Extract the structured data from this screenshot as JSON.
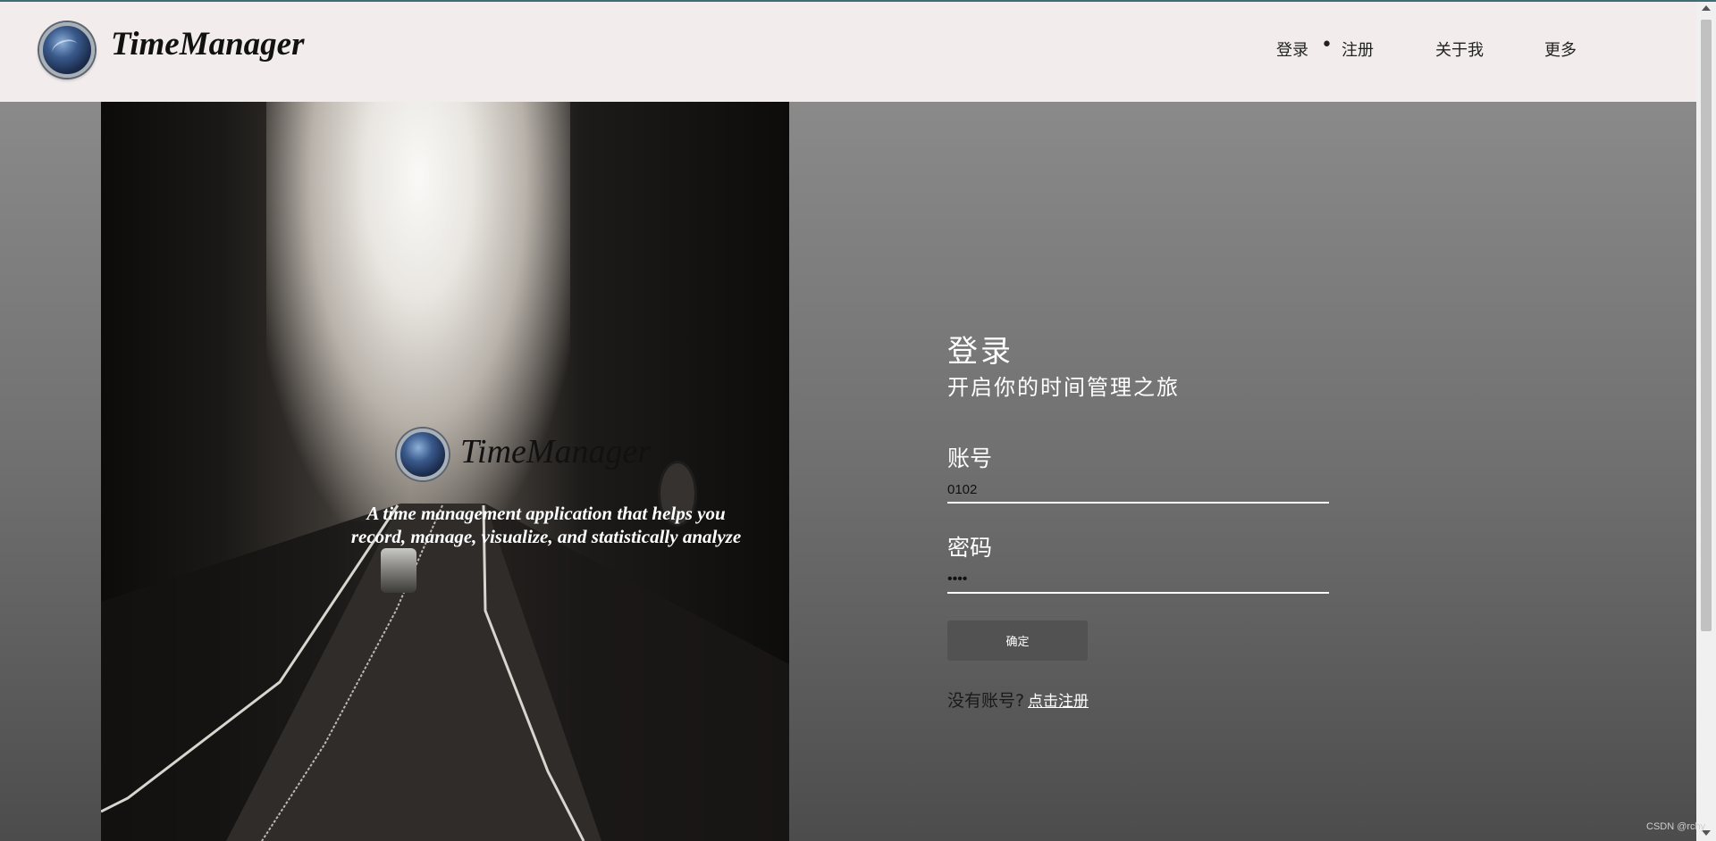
{
  "header": {
    "brand": "TimeManager",
    "nav": {
      "login": "登录",
      "separator": "•",
      "register": "注册",
      "about": "关于我",
      "more": "更多"
    }
  },
  "hero": {
    "brand": "TimeManager",
    "tagline": "A time management application that helps you record, manage, visualize, and statistically analyze"
  },
  "login": {
    "title": "登录",
    "subtitle": "开启你的时间管理之旅",
    "account_label": "账号",
    "account_value": "0102",
    "password_label": "密码",
    "password_value": "1234",
    "submit_label": "确定",
    "no_account_text": "没有账号?",
    "register_link": "点击注册"
  },
  "watermark": "CSDN @rchy",
  "colors": {
    "header_bg": "#f2ecec",
    "button_bg": "#525252",
    "accent": "#3d6e78"
  }
}
